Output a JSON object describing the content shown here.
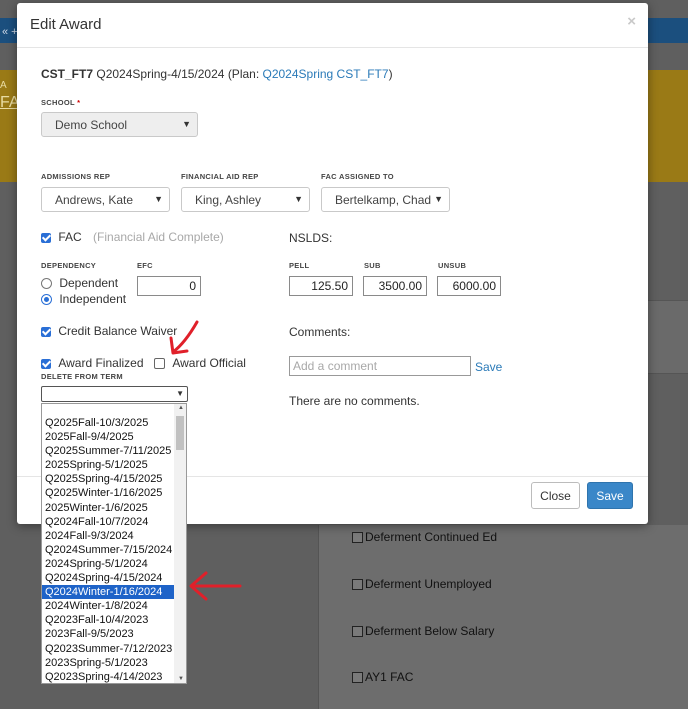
{
  "background": {
    "topbar_fragment": "« +",
    "yellow_fragment_small": "A",
    "yellow_fragment_large": "FA",
    "checkboxes": [
      {
        "label": "Deferment Continued Ed"
      },
      {
        "label": "Deferment Unemployed"
      },
      {
        "label": "Deferment Below Salary"
      },
      {
        "label": "AY1 FAC"
      }
    ]
  },
  "modal": {
    "title": "Edit Award",
    "close_glyph": "×",
    "student_id": "CST_FT7",
    "award_term": "Q2024Spring-4/15/2024",
    "plan_prefix": "(Plan: ",
    "plan_link": "Q2024Spring CST_FT7",
    "plan_suffix": ")",
    "school": {
      "label": "SCHOOL",
      "required_mark": "*",
      "value": "Demo School"
    },
    "admissions_rep": {
      "label": "ADMISSIONS REP",
      "value": "Andrews, Kate"
    },
    "financial_aid_rep": {
      "label": "FINANCIAL AID REP",
      "value": "King, Ashley"
    },
    "fac_assigned_to": {
      "label": "FAC ASSIGNED TO",
      "value": "Bertelkamp, Chad"
    },
    "fac": {
      "label": "FAC",
      "hint": "(Financial Aid Complete)",
      "checked": true
    },
    "nslds_label": "NSLDS:",
    "dependency": {
      "label": "DEPENDENCY",
      "options": [
        "Dependent",
        "Independent"
      ],
      "selected": "Independent"
    },
    "efc": {
      "label": "EFC",
      "value": "0"
    },
    "pell": {
      "label": "PELL",
      "value": "125.50"
    },
    "sub": {
      "label": "SUB",
      "value": "3500.00"
    },
    "unsub": {
      "label": "UNSUB",
      "value": "6000.00"
    },
    "credit_balance_waiver": {
      "label": "Credit Balance Waiver",
      "checked": true
    },
    "award_finalized": {
      "label": "Award Finalized",
      "checked": true
    },
    "award_official": {
      "label": "Award Official",
      "checked": false
    },
    "comments": {
      "label": "Comments:",
      "placeholder": "Add a comment",
      "save_link": "Save",
      "empty_text": "There are no comments."
    },
    "delete_from_term": {
      "label": "DELETE FROM TERM",
      "value": "",
      "options": [
        "Q2025Fall-10/3/2025",
        "2025Fall-9/4/2025",
        "Q2025Summer-7/11/2025",
        "2025Spring-5/1/2025",
        "Q2025Spring-4/15/2025",
        "Q2025Winter-1/16/2025",
        "2025Winter-1/6/2025",
        "Q2024Fall-10/7/2024",
        "2024Fall-9/3/2024",
        "Q2024Summer-7/15/2024",
        "2024Spring-5/1/2024",
        "Q2024Spring-4/15/2024",
        "Q2024Winter-1/16/2024",
        "2024Winter-1/8/2024",
        "Q2023Fall-10/4/2023",
        "2023Fall-9/5/2023",
        "Q2023Summer-7/12/2023",
        "2023Spring-5/1/2023",
        "Q2023Spring-4/14/2023"
      ],
      "highlighted": "Q2024Winter-1/16/2024"
    },
    "buttons": {
      "close": "Close",
      "save": "Save"
    }
  },
  "colors": {
    "primary": "#3a87c8",
    "link": "#2a7ab8",
    "annotation": "#e0202a",
    "highlight": "#1e63c8"
  }
}
